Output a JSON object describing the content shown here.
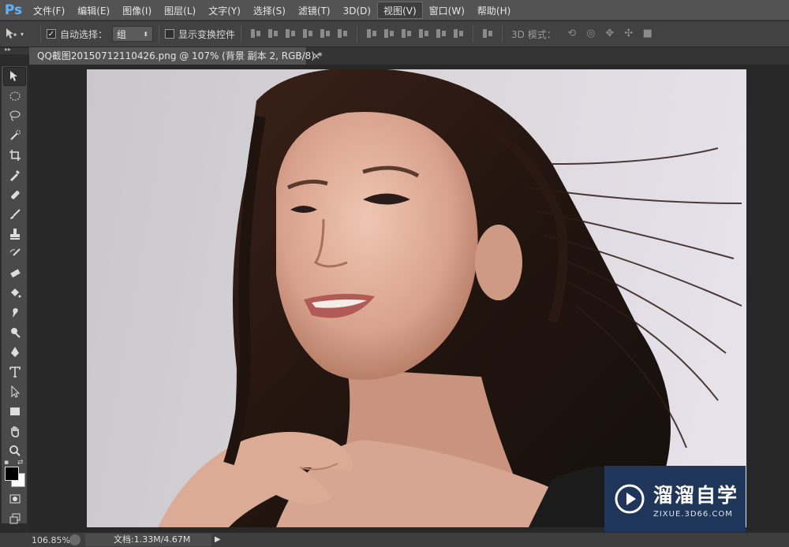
{
  "app": {
    "logo": "Ps"
  },
  "menu": [
    "文件(F)",
    "编辑(E)",
    "图像(I)",
    "图层(L)",
    "文字(Y)",
    "选择(S)",
    "滤镜(T)",
    "3D(D)",
    "视图(V)",
    "窗口(W)",
    "帮助(H)"
  ],
  "menu_active_index": 8,
  "options": {
    "auto_select_label": "自动选择：",
    "auto_select_checked": true,
    "group_value": "组",
    "show_transform_label": "显示变换控件",
    "show_transform_checked": false,
    "mode_3d_label": "3D 模式："
  },
  "document": {
    "tab_title": "QQ截图20150712110426.png @ 107% (背景 副本 2, RGB/8) *",
    "close_glyph": "×"
  },
  "status": {
    "zoom": "106.85%",
    "doc_info": "文档:1.33M/4.67M"
  },
  "watermark": {
    "title": "溜溜自学",
    "url": "ZIXUE.3D66.COM"
  },
  "colors": {
    "accent": "#5fb3ff",
    "menu_bg": "#535353",
    "canvas_bg": "#282828",
    "watermark_bg": "#1f3559"
  }
}
